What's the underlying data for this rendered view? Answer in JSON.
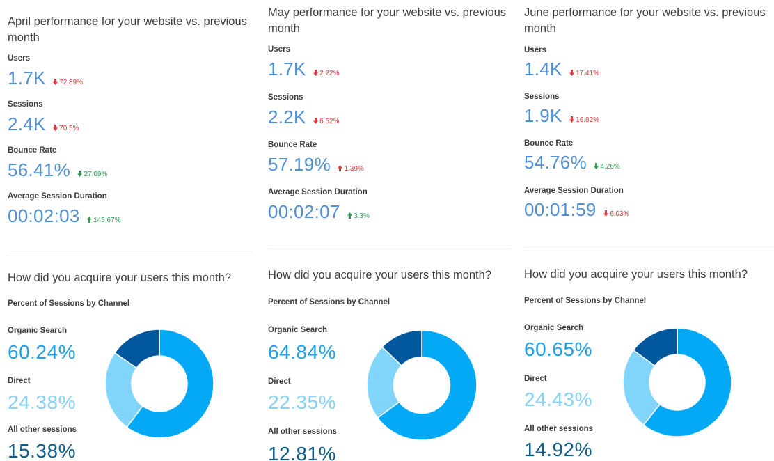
{
  "colors": {
    "organic": "#03a9f4",
    "direct": "#81d4fa",
    "other": "#01579b",
    "metric_value": "#4f8fd6",
    "delta_down": "#d93b3b",
    "delta_up": "#2e9a4e"
  },
  "panels": [
    {
      "title": "April performance for your website vs. previous month",
      "metrics": [
        {
          "label": "Users",
          "value": "1.7K",
          "delta": "72.89%",
          "direction": "down",
          "tone": "down"
        },
        {
          "label": "Sessions",
          "value": "2.4K",
          "delta": "70.5%",
          "direction": "down",
          "tone": "down"
        },
        {
          "label": "Bounce Rate",
          "value": "56.41%",
          "delta": "27.09%",
          "direction": "down",
          "tone": "up"
        },
        {
          "label": "Average Session Duration",
          "value": "00:02:03",
          "delta": "145.67%",
          "direction": "up",
          "tone": "up"
        }
      ],
      "acquisition": {
        "title": "How did you acquire your users this month?",
        "subtitle": "Percent of Sessions by Channel",
        "channels": [
          {
            "label": "Organic Search",
            "value": "60.24%",
            "share": 60.24
          },
          {
            "label": "Direct",
            "value": "24.38%",
            "share": 24.38
          },
          {
            "label": "All other sessions",
            "value": "15.38%",
            "share": 15.38
          }
        ]
      }
    },
    {
      "title": "May performance for your website vs. previous month",
      "metrics": [
        {
          "label": "Users",
          "value": "1.7K",
          "delta": "2.22%",
          "direction": "down",
          "tone": "down"
        },
        {
          "label": "Sessions",
          "value": "2.2K",
          "delta": "6.52%",
          "direction": "down",
          "tone": "down"
        },
        {
          "label": "Bounce Rate",
          "value": "57.19%",
          "delta": "1.39%",
          "direction": "up",
          "tone": "down"
        },
        {
          "label": "Average Session Duration",
          "value": "00:02:07",
          "delta": "3.3%",
          "direction": "up",
          "tone": "up"
        }
      ],
      "acquisition": {
        "title": "How did you acquire your users this month?",
        "subtitle": "Percent of Sessions by Channel",
        "channels": [
          {
            "label": "Organic Search",
            "value": "64.84%",
            "share": 64.84
          },
          {
            "label": "Direct",
            "value": "22.35%",
            "share": 22.35
          },
          {
            "label": "All other sessions",
            "value": "12.81%",
            "share": 12.81
          }
        ]
      }
    },
    {
      "title": "June performance for your website vs. previous month",
      "metrics": [
        {
          "label": "Users",
          "value": "1.4K",
          "delta": "17.41%",
          "direction": "down",
          "tone": "down"
        },
        {
          "label": "Sessions",
          "value": "1.9K",
          "delta": "16.82%",
          "direction": "down",
          "tone": "down"
        },
        {
          "label": "Bounce Rate",
          "value": "54.76%",
          "delta": "4.26%",
          "direction": "down",
          "tone": "up"
        },
        {
          "label": "Average Session Duration",
          "value": "00:01:59",
          "delta": "6.03%",
          "direction": "down",
          "tone": "down"
        }
      ],
      "acquisition": {
        "title": "How did you acquire your users this month?",
        "subtitle": "Percent of Sessions by Channel",
        "channels": [
          {
            "label": "Organic Search",
            "value": "60.65%",
            "share": 60.65
          },
          {
            "label": "Direct",
            "value": "24.43%",
            "share": 24.43
          },
          {
            "label": "All other sessions",
            "value": "14.92%",
            "share": 14.92
          }
        ]
      }
    }
  ]
}
